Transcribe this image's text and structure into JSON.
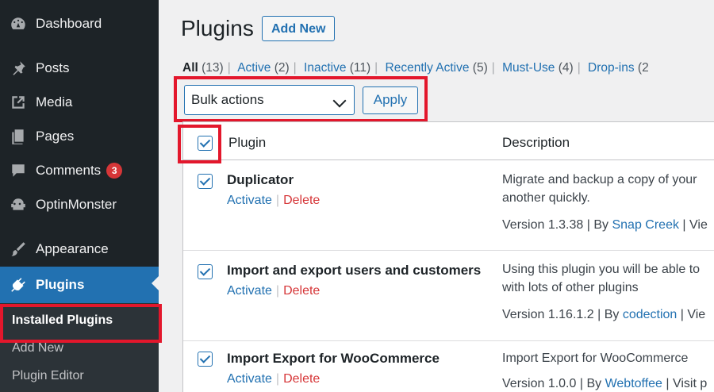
{
  "sidebar": {
    "items": [
      {
        "label": "Dashboard",
        "icon": "dashboard-icon"
      },
      {
        "label": "Posts",
        "icon": "pin-icon"
      },
      {
        "label": "Media",
        "icon": "media-icon"
      },
      {
        "label": "Pages",
        "icon": "pages-icon"
      },
      {
        "label": "Comments",
        "icon": "comment-icon",
        "badge": "3"
      },
      {
        "label": "OptinMonster",
        "icon": "monster-icon"
      },
      {
        "label": "Appearance",
        "icon": "paintbrush-icon"
      },
      {
        "label": "Plugins",
        "icon": "plugin-icon"
      }
    ],
    "submenu": [
      "Installed Plugins",
      "Add New",
      "Plugin Editor"
    ]
  },
  "header": {
    "title": "Plugins",
    "add_new_label": "Add New"
  },
  "filters": [
    {
      "label": "All",
      "count": "(13)"
    },
    {
      "label": "Active",
      "count": "(2)"
    },
    {
      "label": "Inactive",
      "count": "(11)"
    },
    {
      "label": "Recently Active",
      "count": "(5)"
    },
    {
      "label": "Must-Use",
      "count": "(4)"
    },
    {
      "label": "Drop-ins",
      "count": "(2"
    }
  ],
  "bulk": {
    "selected": "Bulk actions",
    "apply_label": "Apply"
  },
  "table": {
    "headers": {
      "plugin": "Plugin",
      "description": "Description"
    },
    "rows": [
      {
        "name": "Duplicator",
        "activate": "Activate",
        "delete": "Delete",
        "desc_line1": "Migrate and backup a copy of your",
        "desc_line2": "another quickly.",
        "version": "Version 1.3.38 | By",
        "author": "Snap Creek",
        "tail": "| Vie"
      },
      {
        "name": "Import and export users and customers",
        "activate": "Activate",
        "delete": "Delete",
        "desc_line1": "Using this plugin you will be able to",
        "desc_line2": "with lots of other plugins",
        "version": "Version 1.16.1.2 | By",
        "author": "codection",
        "tail": "| Vie"
      },
      {
        "name": "Import Export for WooCommerce",
        "activate": "Activate",
        "delete": "Delete",
        "desc_line1": "Import Export for WooCommerce",
        "desc_line2": "",
        "version": "Version 1.0.0 | By",
        "author": "Webtoffee",
        "tail": "| Visit p"
      }
    ]
  },
  "colors": {
    "accent": "#2271b1",
    "sidebar": "#1d2327",
    "highlight": "#e3172c",
    "delete": "#d63638"
  }
}
